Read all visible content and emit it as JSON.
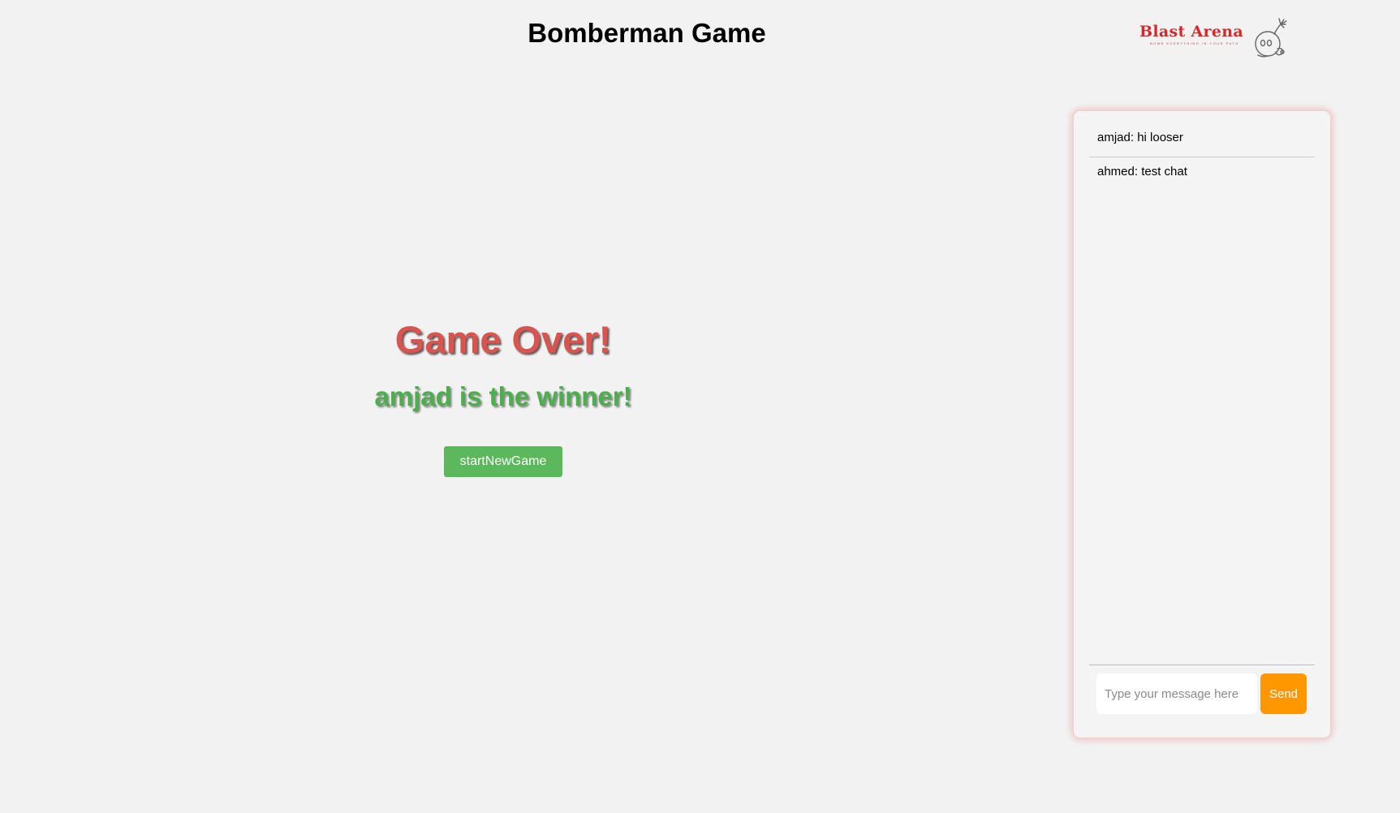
{
  "header": {
    "title": "Bomberman Game",
    "logo": {
      "text": "Blast Arena",
      "tagline": "BOMB EVERYTHING IN YOUR PATH",
      "icon": "bomb-character-icon"
    }
  },
  "game_over": {
    "title": "Game Over!",
    "winner_text": "amjad is the winner!",
    "new_game_label": "startNewGame"
  },
  "chat": {
    "messages": [
      {
        "text": "amjad: hi looser"
      },
      {
        "text": "ahmed: test chat"
      }
    ],
    "input": {
      "value": "",
      "placeholder": "Type your message here"
    },
    "send_label": "Send"
  },
  "colors": {
    "background": "#f2f2f2",
    "game_over_red": "#d9534f",
    "winner_green": "#4cae4c",
    "button_green": "#5cb85c",
    "send_orange": "#ff9800",
    "logo_red": "#d42a2a"
  }
}
